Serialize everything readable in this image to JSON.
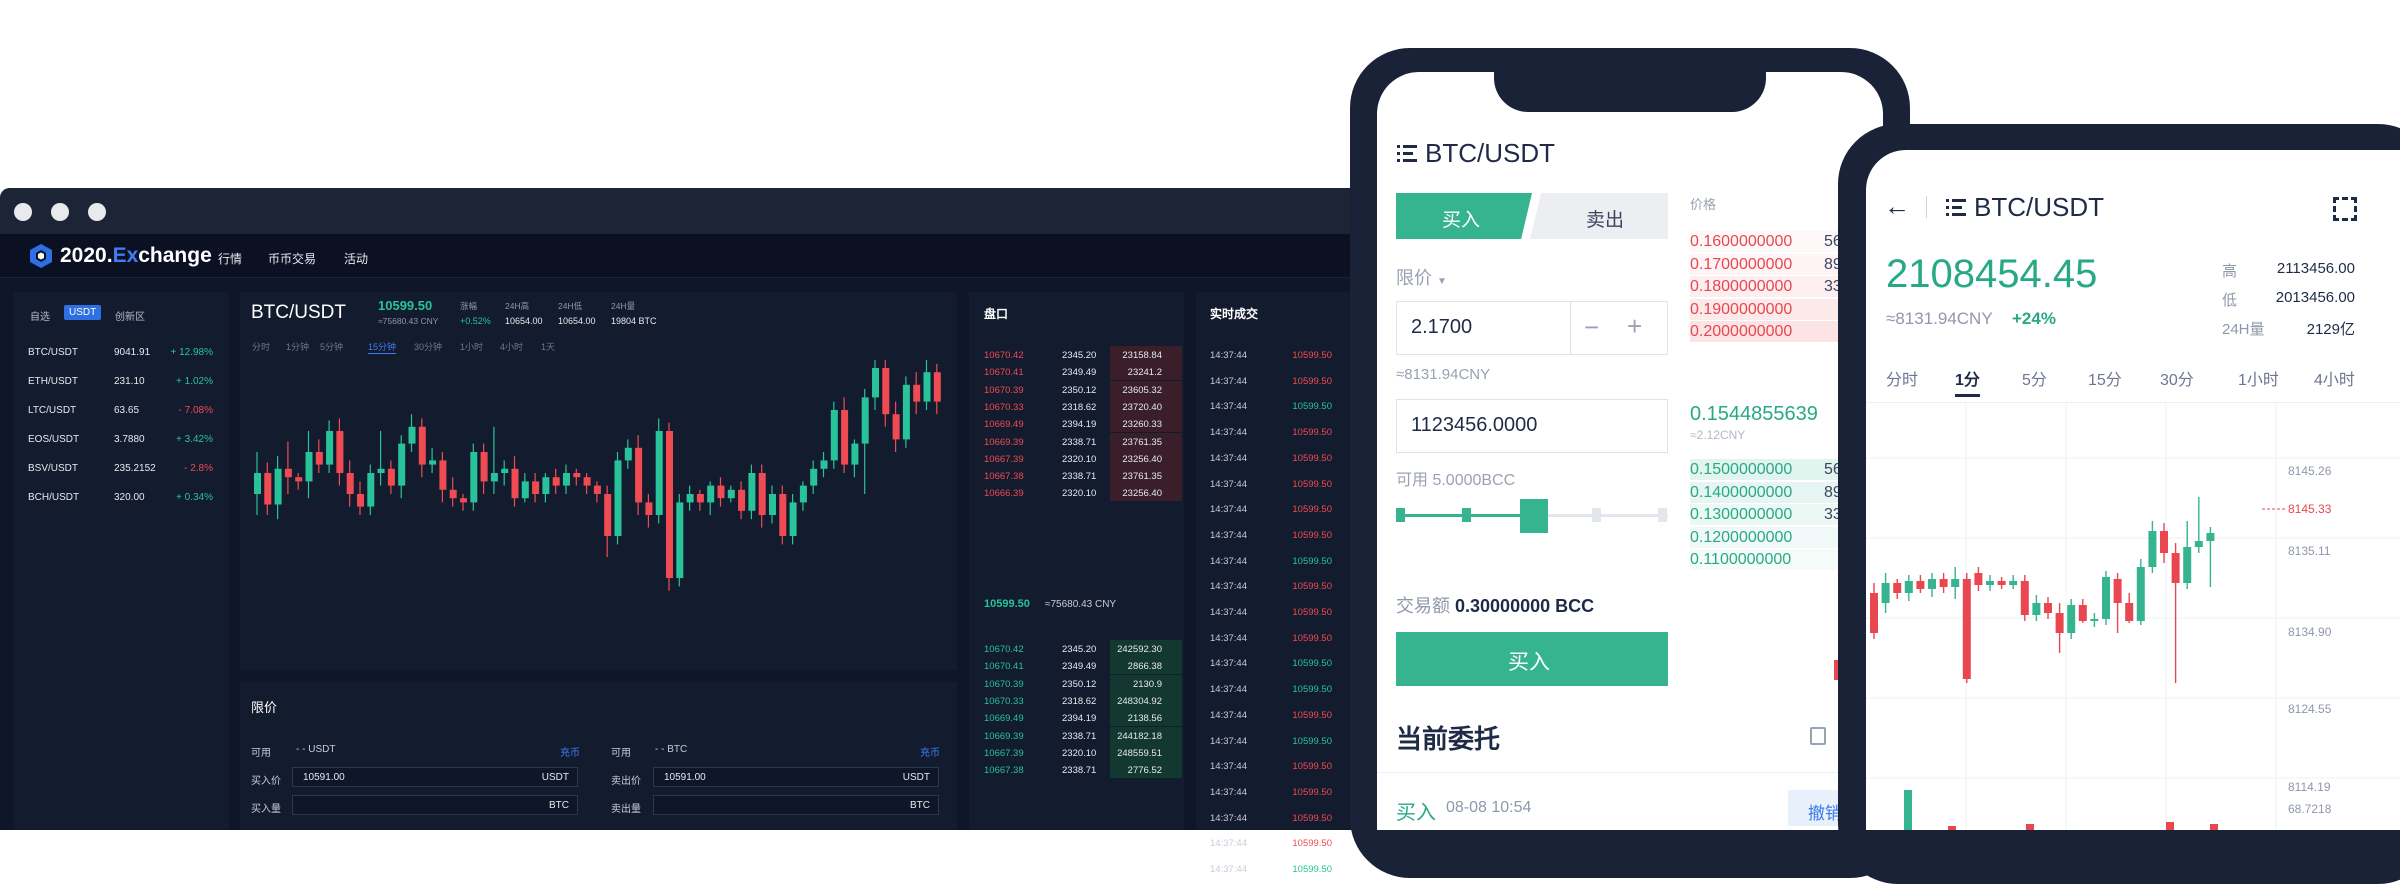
{
  "desktop": {
    "logo": {
      "prefix": "2020.",
      "ex": "Ex",
      "suffix": "change"
    },
    "nav": [
      "行情",
      "币币交易",
      "活动"
    ],
    "market_tabs": [
      "自选",
      "USDT",
      "创新区"
    ],
    "market_rows": [
      {
        "pair": "BTC/USDT",
        "price": "9041.91",
        "change": "+ 12.98%",
        "dir": "up"
      },
      {
        "pair": "ETH/USDT",
        "price": "231.10",
        "change": "+ 1.02%",
        "dir": "up"
      },
      {
        "pair": "LTC/USDT",
        "price": "63.65",
        "change": "- 7.08%",
        "dir": "down"
      },
      {
        "pair": "EOS/USDT",
        "price": "3.7880",
        "change": "+ 3.42%",
        "dir": "up"
      },
      {
        "pair": "BSV/USDT",
        "price": "235.2152",
        "change": "- 2.8%",
        "dir": "down"
      },
      {
        "pair": "BCH/USDT",
        "price": "320.00",
        "change": "+ 0.34%",
        "dir": "up"
      }
    ],
    "pair": "BTC/USDT",
    "last_price": "10599.50",
    "last_cny": "≈75680.43 CNY",
    "stats": [
      {
        "label": "涨幅",
        "value": "+0.52%",
        "cls": "green"
      },
      {
        "label": "24H高",
        "value": "10654.00",
        "cls": ""
      },
      {
        "label": "24H低",
        "value": "10654.00",
        "cls": ""
      },
      {
        "label": "24H量",
        "value": "19804 BTC",
        "cls": ""
      }
    ],
    "intervals": [
      "分时",
      "1分钟",
      "5分钟",
      "15分钟",
      "30分钟",
      "1小时",
      "4小时",
      "1天"
    ],
    "active_interval": "15分钟",
    "orderbook_title": "盘口",
    "trades_title": "实时成交",
    "asks": [
      [
        "10670.42",
        "2345.20",
        "23158.84"
      ],
      [
        "10670.41",
        "2349.49",
        "23241.2"
      ],
      [
        "10670.39",
        "2350.12",
        "23605.32"
      ],
      [
        "10670.33",
        "2318.62",
        "23720.40"
      ],
      [
        "10669.49",
        "2394.19",
        "23260.33"
      ],
      [
        "10669.39",
        "2338.71",
        "23761.35"
      ],
      [
        "10667.39",
        "2320.10",
        "23256.40"
      ],
      [
        "10667.38",
        "2338.71",
        "23761.35"
      ],
      [
        "10666.39",
        "2320.10",
        "23256.40"
      ]
    ],
    "mid_price": "10599.50",
    "mid_cny": "≈75680.43 CNY",
    "bids": [
      [
        "10670.42",
        "2345.20",
        "242592.30"
      ],
      [
        "10670.41",
        "2349.49",
        "2866.38"
      ],
      [
        "10670.39",
        "2350.12",
        "2130.9"
      ],
      [
        "10670.33",
        "2318.62",
        "248304.92"
      ],
      [
        "10669.49",
        "2394.19",
        "2138.56"
      ],
      [
        "10669.39",
        "2338.71",
        "244182.18"
      ],
      [
        "10667.39",
        "2320.10",
        "248559.51"
      ],
      [
        "10667.38",
        "2338.71",
        "2776.52"
      ]
    ],
    "trades": [
      {
        "time": "14:37:44",
        "price": "10599.50",
        "dir": "down"
      },
      {
        "time": "14:37:44",
        "price": "10599.50",
        "dir": "down"
      },
      {
        "time": "14:37:44",
        "price": "10599.50",
        "dir": "up"
      },
      {
        "time": "14:37:44",
        "price": "10599.50",
        "dir": "down"
      },
      {
        "time": "14:37:44",
        "price": "10599.50",
        "dir": "down"
      },
      {
        "time": "14:37:44",
        "price": "10599.50",
        "dir": "down"
      },
      {
        "time": "14:37:44",
        "price": "10599.50",
        "dir": "down"
      },
      {
        "time": "14:37:44",
        "price": "10599.50",
        "dir": "down"
      },
      {
        "time": "14:37:44",
        "price": "10599.50",
        "dir": "up"
      },
      {
        "time": "14:37:44",
        "price": "10599.50",
        "dir": "down"
      },
      {
        "time": "14:37:44",
        "price": "10599.50",
        "dir": "down"
      },
      {
        "time": "14:37:44",
        "price": "10599.50",
        "dir": "down"
      },
      {
        "time": "14:37:44",
        "price": "10599.50",
        "dir": "up"
      },
      {
        "time": "14:37:44",
        "price": "10599.50",
        "dir": "up"
      },
      {
        "time": "14:37:44",
        "price": "10599.50",
        "dir": "down"
      },
      {
        "time": "14:37:44",
        "price": "10599.50",
        "dir": "up"
      },
      {
        "time": "14:37:44",
        "price": "10599.50",
        "dir": "down"
      },
      {
        "time": "14:37:44",
        "price": "10599.50",
        "dir": "down"
      },
      {
        "time": "14:37:44",
        "price": "10599.50",
        "dir": "down"
      },
      {
        "time": "14:37:44",
        "price": "10599.50",
        "dir": "down"
      },
      {
        "time": "14:37:44",
        "price": "10599.50",
        "dir": "up"
      }
    ],
    "limit_title": "限价",
    "buy_form": {
      "avail_label": "可用",
      "avail_value": "- - USDT",
      "deposit": "充币",
      "price_label": "买入价",
      "price_value": "10591.00",
      "price_unit": "USDT",
      "amount_label": "买入量",
      "amount_unit": "BTC"
    },
    "sell_form": {
      "avail_label": "可用",
      "avail_value": "- - BTC",
      "deposit": "充币",
      "price_label": "卖出价",
      "price_value": "10591.00",
      "price_unit": "USDT",
      "amount_label": "卖出量",
      "amount_unit": "BTC"
    }
  },
  "phone1": {
    "title": "BTC/USDT",
    "buy_tab": "买入",
    "sell_tab": "卖出",
    "order_type": "限价",
    "price_input": "2.1700",
    "price_cny": "≈8131.94CNY",
    "amount_input": "1123456.0000",
    "available": "可用 5.0000BCC",
    "volume_label": "交易额",
    "volume_value": "0.30000000 BCC",
    "buy_button": "买入",
    "orders_title": "当前委托",
    "order_side": "买入",
    "order_time": "08-08 10:54",
    "cancel": "撤销",
    "price_header": "价格",
    "asks": [
      "0.1600000000",
      "0.1700000000",
      "0.1800000000",
      "0.1900000000",
      "0.2000000000"
    ],
    "ask_amounts": [
      "56",
      "89",
      "33",
      "",
      ""
    ],
    "last": "0.1544855639",
    "last_cny": "≈2.12CNY",
    "bids": [
      "0.1500000000",
      "0.1400000000",
      "0.1300000000",
      "0.1200000000",
      "0.1100000000"
    ],
    "bid_amounts": [
      "56",
      "89",
      "33",
      "",
      ""
    ]
  },
  "phone2": {
    "title": "BTC/USDT",
    "price": "2108454.45",
    "cny": "≈8131.94CNY",
    "change": "+24%",
    "stats": [
      {
        "label": "高",
        "value": "2113456.00"
      },
      {
        "label": "低",
        "value": "2013456.00"
      },
      {
        "label": "24H量",
        "value": "2129亿"
      }
    ],
    "tabs": [
      "分时",
      "1分",
      "5分",
      "15分",
      "30分",
      "1小时",
      "4小时"
    ],
    "active_tab": "1分",
    "axis": [
      "8145.26",
      "8145.33",
      "8135.11",
      "8134.90",
      "8124.55",
      "8114.19",
      "68.7218"
    ]
  },
  "colors": {
    "up": "#28c39a",
    "down": "#f04b52",
    "accent": "#2f6fe4",
    "mobile_green": "#36b38f"
  },
  "chart_data": {
    "type": "candlestick",
    "candles": [
      {
        "o": 1,
        "c": 0
      }
    ]
  }
}
